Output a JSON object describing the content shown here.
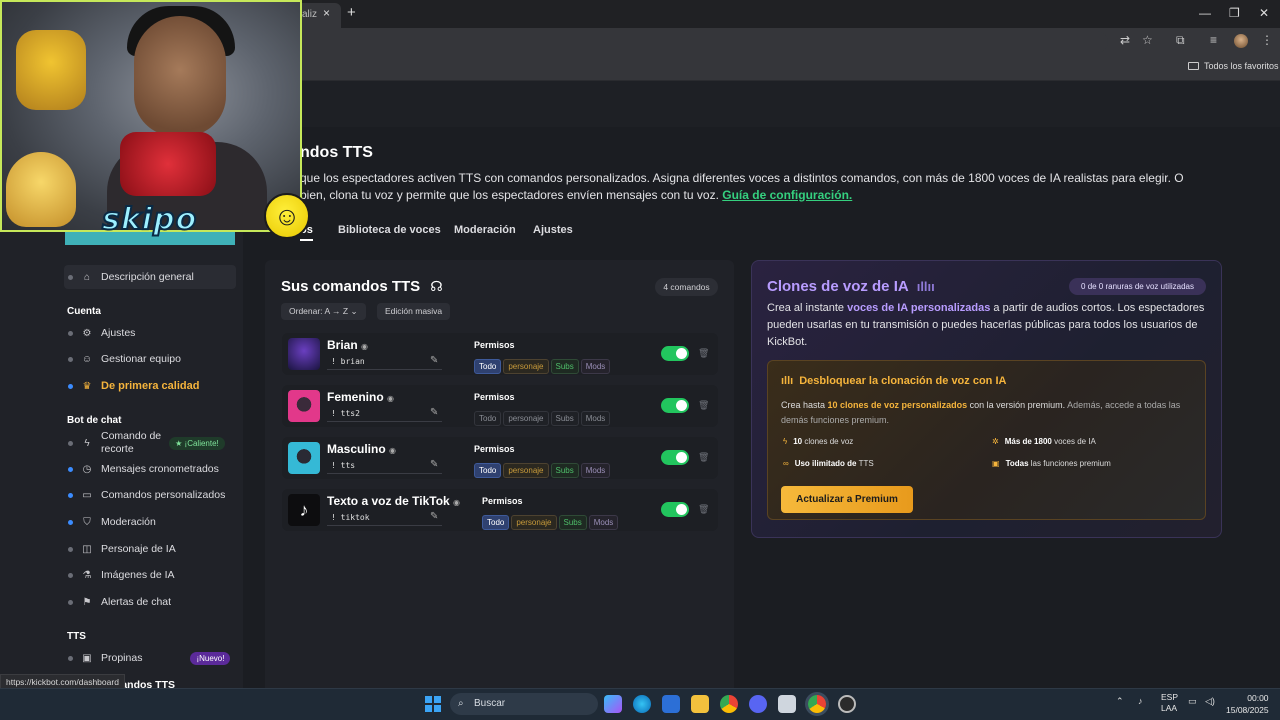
{
  "browser": {
    "tab_title": "aliz",
    "tab_close": "×",
    "new_tab": "+",
    "window_min": "—",
    "window_max": "❐",
    "window_close": "✕",
    "bookmarks_label": "Todos los favoritos"
  },
  "page": {
    "title": "ndos TTS",
    "description_text": "que los espectadores activen TTS con comandos personalizados. Asigna diferentes voces a distintos comandos, con más de 1800 voces de IA realistas para elegir. O bien, clona tu voz y permite que los espectadores envíen mensajes con tu voz.",
    "guide_link": "Guía de configuración.",
    "tabs": {
      "active": "os",
      "voice_library": "Biblioteca de voces",
      "moderation": "Moderación",
      "settings": "Ajustes"
    }
  },
  "sidebar": {
    "overview": "Descripción general",
    "account_heading": "Cuenta",
    "settings": "Ajustes",
    "manage_team": "Gestionar equipo",
    "premium": "De primera calidad",
    "bot_heading": "Bot de chat",
    "clip_command_1": "Comando de",
    "clip_command_2": "recorte",
    "hot_badge": "¡Caliente!",
    "timers": "Mensajes cronometrados",
    "custom_commands": "Comandos personalizados",
    "moderation": "Moderación",
    "ai_character": "Personaje de IA",
    "ai_images": "Imágenes de IA",
    "chat_alerts": "Alertas de chat",
    "tts_heading": "TTS",
    "tips": "Propinas",
    "new_badge": "¡Nuevo!",
    "tts_commands_partial": "mandos TTS"
  },
  "commands": {
    "title": "Sus comandos TTS",
    "count": "4 comandos",
    "sort_label": "Ordenar:",
    "sort_value": "A → Z",
    "bulk_edit": "Edición masiva",
    "permissions_label": "Permisos",
    "chips": {
      "all": "Todo",
      "character": "personaje",
      "subs": "Subs",
      "mods": "Mods"
    },
    "items": [
      {
        "name": "Brian",
        "trigger": "! brian"
      },
      {
        "name": "Femenino",
        "trigger": "! tts2"
      },
      {
        "name": "Masculino",
        "trigger": "! tts"
      },
      {
        "name": "Texto a voz de TikTok",
        "trigger": "! tiktok"
      }
    ]
  },
  "clones": {
    "title": "Clones de voz de IA",
    "slots": "0 de 0 ranuras de voz utilizadas",
    "desc_1": "Crea al instante ",
    "desc_hl": "voces de IA personalizadas",
    "desc_2": " a partir de audios cortos. Los espectadores pueden usarlas en tu transmisión o puedes hacerlas públicas para todos los usuarios de KickBot.",
    "unlock_title": "Desbloquear la clonación de voz con IA",
    "unlock_1": "Crea hasta ",
    "unlock_hl": "10 clones de voz personalizados",
    "unlock_2": " con la versión premium.",
    "unlock_3": " Además, accede a todas las demás funciones premium.",
    "feat_1_b": "10",
    "feat_1": " clones de voz",
    "feat_2_b": "Más de 1800",
    "feat_2": " voces de IA",
    "feat_3_b": "Uso ilimitado de",
    "feat_3": " TTS",
    "feat_4_b": "Todas",
    "feat_4": " las funciones premium",
    "upgrade_button": "Actualizar a Premium"
  },
  "overlay": {
    "logo": "skipo"
  },
  "status_link": "https://kickbot.com/dashboard",
  "taskbar": {
    "search": "Buscar",
    "lang_1": "ESP",
    "lang_2": "LAA",
    "time": "00:00",
    "date": "15/08/2025"
  },
  "colors": {
    "accent_green": "#22c55e",
    "premium_gold": "#f5b43c",
    "clone_violet": "#b89cff",
    "link_green": "#35d07f"
  }
}
